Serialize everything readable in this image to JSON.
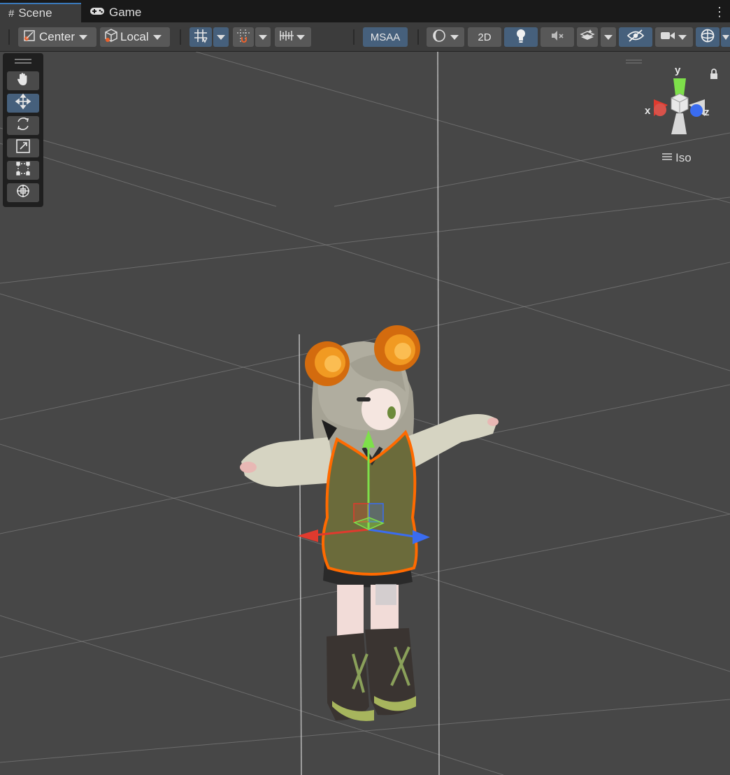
{
  "tabs": [
    {
      "label": "Scene",
      "icon": "hash-icon",
      "active": true
    },
    {
      "label": "Game",
      "icon": "gamepad-icon",
      "active": false
    }
  ],
  "toolbar": {
    "pivot_mode": "Center",
    "pivot_rotation": "Local",
    "msaa_label": "MSAA",
    "twod_label": "2D"
  },
  "gizmo": {
    "axis_y": "y",
    "axis_x": "x",
    "axis_z": "z",
    "projection": "Iso"
  },
  "colors": {
    "accent": "#3a79bb",
    "selection_outline": "#ff6a00",
    "axis_x": "#e03a2e",
    "axis_y": "#7ee04a",
    "axis_z": "#3a6cf0"
  },
  "tools": [
    "hand-tool",
    "move-tool",
    "rotate-tool",
    "scale-tool",
    "rect-tool",
    "transform-tool"
  ],
  "selected_tool": "move-tool"
}
